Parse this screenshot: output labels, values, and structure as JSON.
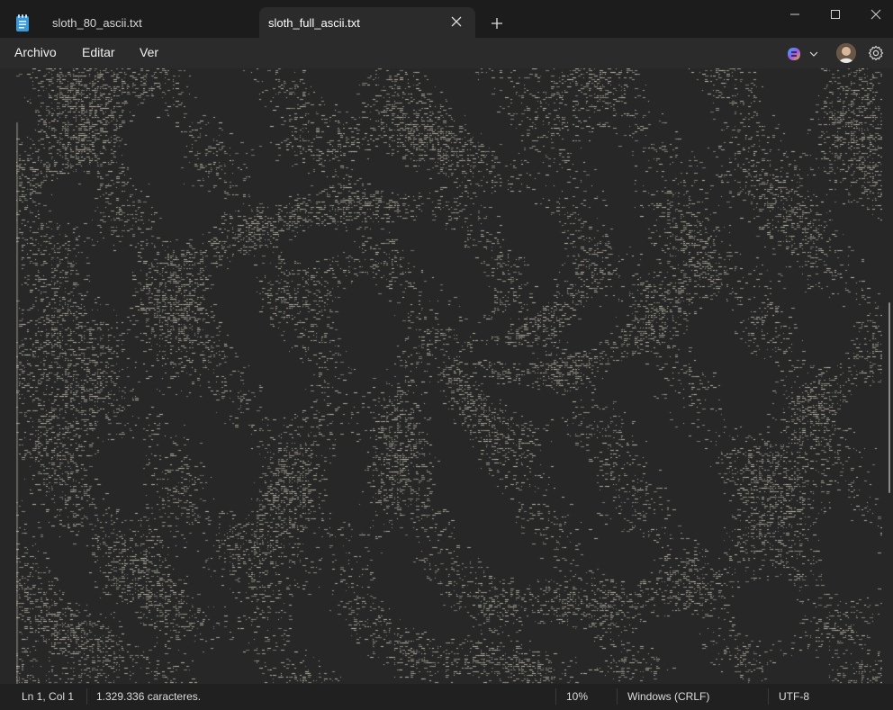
{
  "tabs": [
    {
      "label": "sloth_80_ascii.txt",
      "active": false
    },
    {
      "label": "sloth_full_ascii.txt",
      "active": true
    }
  ],
  "menu": {
    "archivo": "Archivo",
    "editar": "Editar",
    "ver": "Ver"
  },
  "status": {
    "position": "Ln 1, Col 1",
    "characters": "1.329.336 caracteres.",
    "zoom": "10%",
    "line_ending": "Windows (CRLF)",
    "encoding": "UTF-8"
  },
  "icons": {
    "app": "notepad-icon",
    "close_tab": "close-icon",
    "new_tab": "plus-icon",
    "minimize": "minimize-icon",
    "maximize": "maximize-icon",
    "close_window": "close-icon",
    "copilot": "copilot-icon",
    "settings": "gear-icon"
  },
  "colors": {
    "background": "#272727",
    "titlebar": "#1c1c1c",
    "text": "#e6e6e6",
    "ascii_ink": "#cfcbb8",
    "accent_notepad": "#3a9ad9"
  }
}
